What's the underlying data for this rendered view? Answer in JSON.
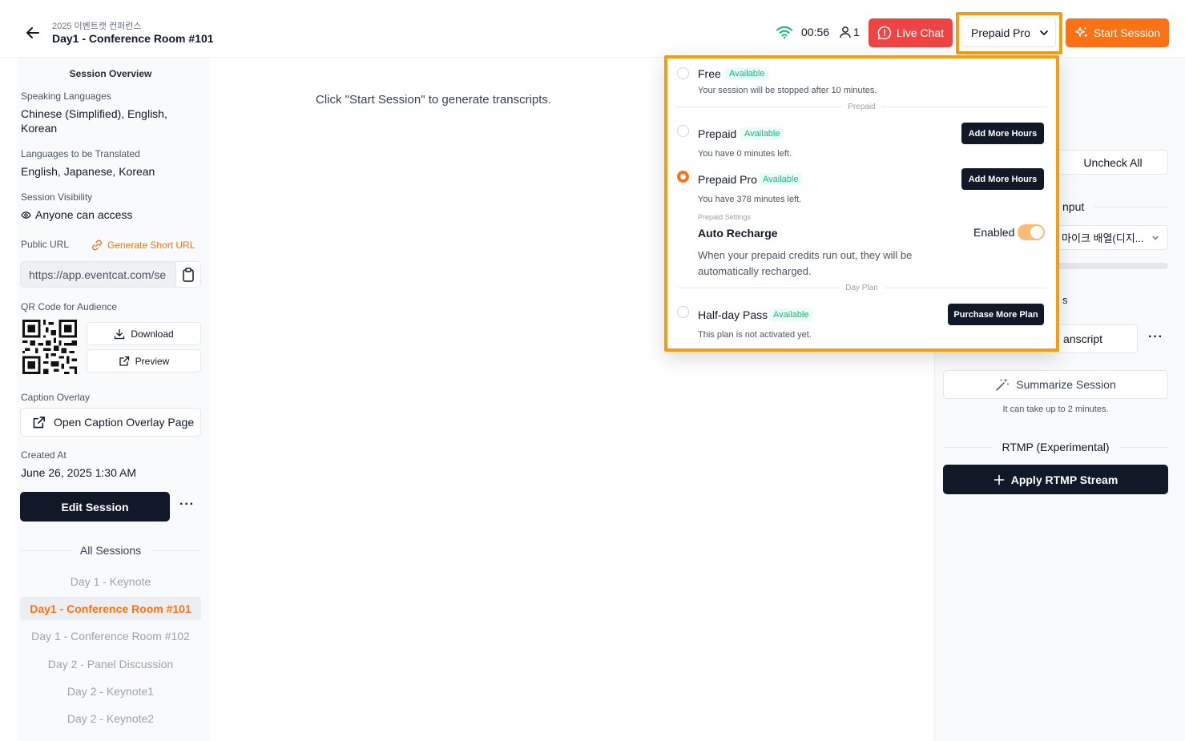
{
  "header": {
    "event_name": "2025 이벤트캣 컨퍼런스",
    "session_name": "Day1 - Conference Room #101",
    "timer": "00:56",
    "participant_count": "1",
    "live_chat_label": "Live Chat",
    "plan_selected": "Prepaid Pro",
    "start_session_label": "Start Session"
  },
  "sidebar": {
    "title": "Session Overview",
    "speaking_languages_label": "Speaking Languages",
    "speaking_languages": "Chinese (Simplified), English, Korean",
    "translated_languages_label": "Languages to be Translated",
    "translated_languages": "English, Japanese, Korean",
    "visibility_label": "Session Visibility",
    "visibility": "Anyone can access",
    "public_url_label": "Public URL",
    "generate_short_url": "Generate Short URL",
    "public_url": "https://app.eventcat.com/se",
    "qr_label": "QR Code for Audience",
    "download_label": "Download",
    "preview_label": "Preview",
    "caption_overlay_label": "Caption Overlay",
    "open_overlay_label": "Open Caption Overlay Page",
    "created_at_label": "Created At",
    "created_at": "June 26, 2025 1:30 AM",
    "edit_session_label": "Edit Session",
    "more_label": "···",
    "all_sessions_label": "All Sessions",
    "sessions": [
      "Day 1 - Keynote",
      "Day1 - Conference Room #101",
      "Day 1 - Conference Room #102",
      "Day 2 - Panel Discussion",
      "Day 2 - Keynote1",
      "Day 2 - Keynote2"
    ]
  },
  "main": {
    "message": "Click \"Start Session\" to generate transcripts."
  },
  "right_panel": {
    "uncheck_all": "Uncheck All",
    "input_label_fragment": "nput",
    "device_fragment": "마이크 배열(디지...",
    "section_fragment": "s",
    "transcript_fragment": "anscript",
    "more_label": "···",
    "summarize_label": "Summarize Session",
    "summarize_note": "It can take up to 2 minutes.",
    "rtmp_title": "RTMP (Experimental)",
    "rtmp_button": "Apply RTMP Stream"
  },
  "plan_dropdown": {
    "free": {
      "name": "Free",
      "badge": "Available",
      "note": "Your session will be stopped after 10 minutes."
    },
    "prepaid_divider": "Prepaid",
    "prepaid": {
      "name": "Prepaid",
      "badge": "Available",
      "note": "You have 0 minutes left.",
      "button": "Add More Hours"
    },
    "prepaid_pro": {
      "name": "Prepaid Pro",
      "badge": "Available",
      "note": "You have 378 minutes left.",
      "button": "Add More Hours"
    },
    "prepaid_settings_label": "Prepaid Settings",
    "auto_recharge_label": "Auto Recharge",
    "auto_recharge_state": "Enabled",
    "auto_recharge_desc_1": "When your prepaid credits run out, they will be",
    "auto_recharge_desc_2": "automatically recharged.",
    "day_plan_divider": "Day Plan",
    "half_day": {
      "name": "Half-day Pass",
      "badge": "Available",
      "note": "This plan is not activated yet.",
      "button": "Purchase More Plan"
    }
  },
  "colors": {
    "accent": "#f97316",
    "danger": "#ef4444",
    "highlight": "#f59e0b",
    "success": "#10b981",
    "dark": "#111827"
  }
}
